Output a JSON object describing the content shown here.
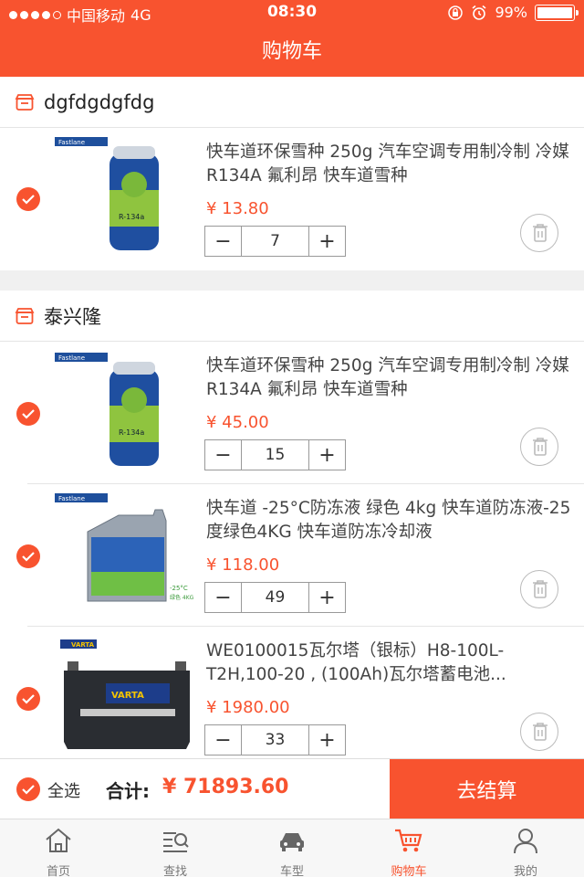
{
  "status_bar": {
    "carrier": "中国移动",
    "network": "4G",
    "time": "08:30",
    "battery": "99%",
    "battery_level": 0.99
  },
  "header": {
    "title": "购物车"
  },
  "colors": {
    "accent": "#f8532f"
  },
  "stores": [
    {
      "name": "dgfdgdgfdg",
      "items": [
        {
          "title": "快车道环保雪种 250g 汽车空调专用制冷制 冷媒 R134A 氟利昂 快车道雪种",
          "price": "¥ 13.80",
          "quantity": "7",
          "image": "refrigerant-can"
        }
      ]
    },
    {
      "name": "泰兴隆",
      "items": [
        {
          "title": "快车道环保雪种 250g 汽车空调专用制冷制 冷媒 R134A 氟利昂 快车道雪种",
          "price": "¥ 45.00",
          "quantity": "15",
          "image": "refrigerant-can"
        },
        {
          "title": "快车道 -25°C防冻液 绿色 4kg 快车道防冻液-25度绿色4KG 快车道防冻冷却液",
          "price": "¥ 118.00",
          "quantity": "49",
          "image": "antifreeze-jug"
        },
        {
          "title": "WE0100015瓦尔塔（银标）H8-100L-T2H,100-20 , (100Ah)瓦尔塔蓄电池...",
          "price": "¥ 1980.00",
          "quantity": "33",
          "image": "car-battery"
        }
      ]
    }
  ],
  "product_images": {
    "brand": "Fastlane",
    "can_label": "R-134a",
    "jug_label": "-25°C",
    "jug_color_label": "绿色 4KG",
    "battery_brand": "VARTA"
  },
  "checkout": {
    "select_all": "全选",
    "total_label": "合计:",
    "total_value": "¥ 71893.60",
    "submit_label": "去结算"
  },
  "tabs": [
    {
      "label": "首页",
      "icon": "home-icon",
      "active": false
    },
    {
      "label": "查找",
      "icon": "search-list-icon",
      "active": false
    },
    {
      "label": "车型",
      "icon": "car-icon",
      "active": false
    },
    {
      "label": "购物车",
      "icon": "cart-icon",
      "active": true
    },
    {
      "label": "我的",
      "icon": "user-icon",
      "active": false
    }
  ]
}
